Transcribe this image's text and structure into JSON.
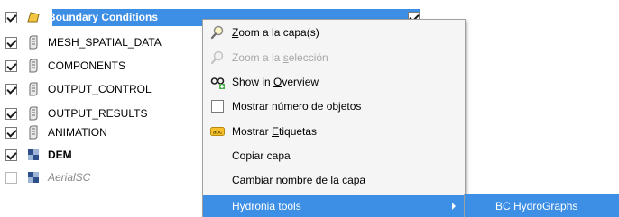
{
  "layers": [
    {
      "label": "Boundary Conditions",
      "checked": true,
      "icon": "polygon-layer-icon",
      "style": "selected"
    },
    {
      "label": "MESH_SPATIAL_DATA",
      "checked": true,
      "icon": "vector-layer-icon",
      "style": "normal"
    },
    {
      "label": "COMPONENTS",
      "checked": true,
      "icon": "vector-layer-icon",
      "style": "normal"
    },
    {
      "label": "OUTPUT_CONTROL",
      "checked": true,
      "icon": "vector-layer-icon",
      "style": "normal"
    },
    {
      "label": "OUTPUT_RESULTS",
      "checked": true,
      "icon": "vector-layer-icon",
      "style": "normal"
    },
    {
      "label": "ANIMATION",
      "checked": true,
      "icon": "vector-layer-icon",
      "style": "normal"
    },
    {
      "label": "DEM",
      "checked": true,
      "icon": "raster-layer-icon",
      "style": "bold"
    },
    {
      "label": "AerialSC",
      "checked": false,
      "icon": "raster-layer-icon",
      "style": "italic"
    }
  ],
  "context_menu": {
    "zoom_layer": {
      "pre": "",
      "u": "Z",
      "post": "oom a la capa(s)",
      "icon": "zoom-icon"
    },
    "zoom_selection": {
      "pre": "Zoom a la ",
      "u": "s",
      "post": "elección",
      "icon": "zoom-icon"
    },
    "show_overview": {
      "pre": "Show in ",
      "u": "O",
      "post": "verview",
      "icon": "overview-icon"
    },
    "feature_count": {
      "label": "Mostrar número de objetos",
      "icon": "checkbox-icon"
    },
    "show_labels": {
      "pre": "Mostrar ",
      "u": "E",
      "post": "tiquetas",
      "icon": "labels-icon",
      "badge": "abc"
    },
    "copy_layer": {
      "label": "Copiar capa"
    },
    "rename_layer": {
      "pre": "Cambiar ",
      "u": "n",
      "post": "ombre de la capa"
    },
    "hydronia_tools": {
      "label": "Hydronia tools"
    }
  },
  "submenu": {
    "bc_hydrographs": {
      "label": "BC HydroGraphs"
    }
  },
  "colors": {
    "selection": "#3d8ee5",
    "menu_bg": "#f5f5f5"
  }
}
